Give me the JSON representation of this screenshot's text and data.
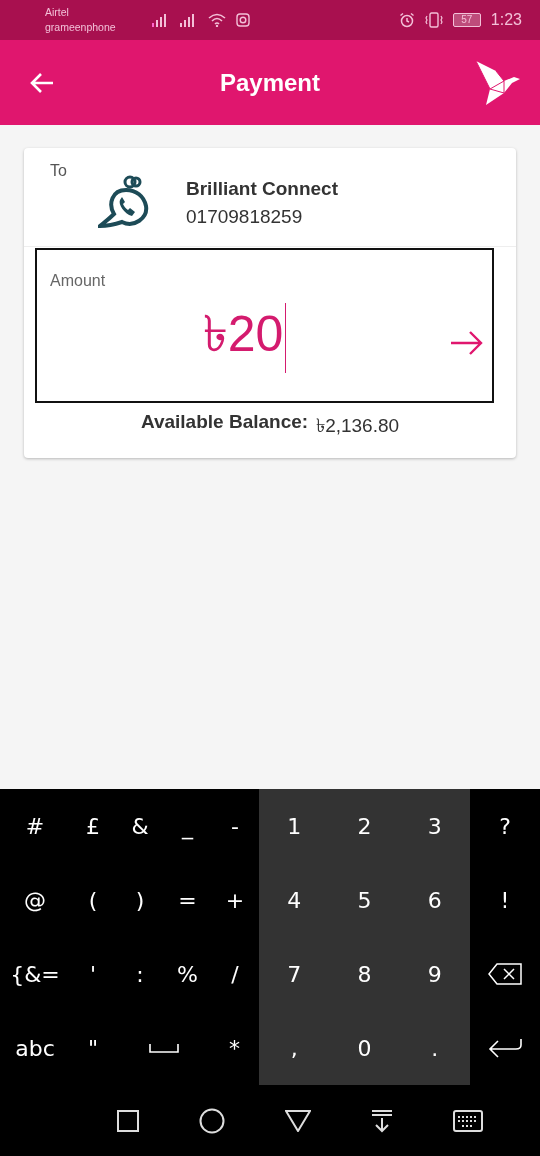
{
  "status_bar": {
    "carriers": [
      "Airtel",
      "grameenphone"
    ],
    "battery": "57",
    "time": "1:23"
  },
  "app_bar": {
    "title": "Payment"
  },
  "recipient": {
    "label": "To",
    "name": "Brilliant Connect",
    "number": "01709818259"
  },
  "amount": {
    "label": "Amount",
    "value": "৳20"
  },
  "balance": {
    "label": "Available Balance:",
    "value": "৳2,136.80"
  },
  "keyboard": {
    "symbol_rows": [
      [
        {
          "kind": "sym",
          "label": "#"
        },
        {
          "kind": "sym",
          "label": "£"
        },
        {
          "kind": "sym",
          "label": "&"
        },
        {
          "kind": "sym",
          "label": "_"
        },
        {
          "kind": "sym",
          "label": "-"
        }
      ],
      [
        {
          "kind": "sym",
          "label": "@"
        },
        {
          "kind": "sym",
          "label": "("
        },
        {
          "kind": "sym",
          "label": ")"
        },
        {
          "kind": "sym",
          "label": "="
        },
        {
          "kind": "sym",
          "label": "+"
        }
      ],
      [
        {
          "kind": "sym",
          "label": "{&="
        },
        {
          "kind": "sym",
          "label": "'"
        },
        {
          "kind": "sym",
          "label": ":"
        },
        {
          "kind": "sym",
          "label": "%"
        },
        {
          "kind": "sym",
          "label": "/"
        }
      ],
      [
        {
          "kind": "sym",
          "label": "abc"
        },
        {
          "kind": "sym",
          "label": "\""
        },
        {
          "kind": "space"
        },
        {
          "kind": "sym",
          "label": "*"
        }
      ]
    ],
    "number_keys": [
      {
        "kind": "num",
        "label": "1"
      },
      {
        "kind": "num",
        "label": "2"
      },
      {
        "kind": "num",
        "label": "3"
      },
      {
        "kind": "num",
        "label": "4"
      },
      {
        "kind": "num",
        "label": "5"
      },
      {
        "kind": "num",
        "label": "6"
      },
      {
        "kind": "num",
        "label": "7"
      },
      {
        "kind": "num",
        "label": "8"
      },
      {
        "kind": "num",
        "label": "9"
      },
      {
        "kind": "num",
        "label": ","
      },
      {
        "kind": "num",
        "label": "0"
      },
      {
        "kind": "num",
        "label": "."
      }
    ],
    "side_keys": [
      {
        "kind": "sym",
        "label": "?"
      },
      {
        "kind": "sym",
        "label": "!"
      },
      {
        "kind": "backspace"
      },
      {
        "kind": "enter"
      }
    ]
  }
}
